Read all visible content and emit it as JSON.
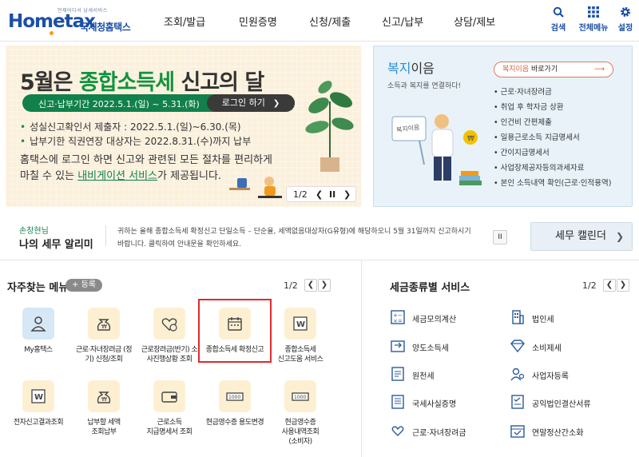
{
  "header": {
    "logo_tag": "언제어디서 납세서비스",
    "logo_text": "Hometax",
    "logo_sub": "국세청홈택스",
    "nav": [
      "조회/발급",
      "민원증명",
      "신청/제출",
      "신고/납부",
      "상담/제보"
    ],
    "util": {
      "search": "검색",
      "menu": "전체메뉴",
      "settings": "설정"
    }
  },
  "banner": {
    "title_prefix": "5월은 ",
    "title_highlight": "종합소득세",
    "title_suffix": " 신고의 달",
    "period": "신고·납부기간  2022.5.1.(일) ~ 5.31.(화)",
    "login_button": "로그인 하기",
    "bullets": [
      "성실신고확인서 제출자 : 2022.5.1.(일)~6.30.(목)",
      "납부기한 직권연장 대상자는 2022.8.31.(수)까지 납부"
    ],
    "desc_line1": "홈택스에 로그인 하면 신고와 관련된 모든 절차를 편리하게",
    "desc_line2_prefix": "마칠 수 있는 ",
    "desc_line2_link": "내비게이션 서비스",
    "desc_line2_suffix": "가 제공됩니다.",
    "pager": "1/2",
    "board_text": "복지이음"
  },
  "promo": {
    "title_blue": "복지",
    "title_rest": "이음",
    "subtitle": "소득과 복지를 연결하다!",
    "button_red": "복지이음",
    "button_rest": " 바로가기",
    "items": [
      "근로·자녀장려금",
      "취업 후 학자금 상환",
      "인건비 간편제출",
      "일용근로소득 지급명세서",
      "간이지급명세서",
      "사업장제공자등의과세자료",
      "본인 소득내역 확인(근로·인적용역)"
    ]
  },
  "notice": {
    "name": "손창현님",
    "title": "나의 세무 알리미",
    "line1": "귀하는 올해 종합소득세 확정신고 단일소득 – 단순율, 세액없음대상자(G유형)에 해당하오니 5월 31일까지 신고하시기",
    "line2": "바랍니다. 클릭하여 안내문을 확인하세요.",
    "pause": "II",
    "calendar": "세무 캘린더"
  },
  "favorites": {
    "title": "자주찾는 메뉴",
    "add": "+ 등록",
    "pager": "1/2",
    "tiles": [
      {
        "label1": "My홈택스",
        "label2": "",
        "label3": ""
      },
      {
        "label1": "근로·자녀장려금 (정",
        "label2": "기) 신청/조회",
        "label3": ""
      },
      {
        "label1": "근로장려금(반기) 소",
        "label2": "사진행상황 조회",
        "label3": ""
      },
      {
        "label1": "종합소득세 확정신고",
        "label2": "",
        "label3": ""
      },
      {
        "label1": "종합소득세",
        "label2": "신고도움 서비스",
        "label3": ""
      },
      {
        "label1": "전자신고결과조회",
        "label2": "",
        "label3": ""
      },
      {
        "label1": "납부할 세액",
        "label2": "조회납부",
        "label3": ""
      },
      {
        "label1": "근로소득",
        "label2": "지급명세서 조회",
        "label3": ""
      },
      {
        "label1": "현금영수증 용도변경",
        "label2": "",
        "label3": ""
      },
      {
        "label1": "현금영수증",
        "label2": "사용내역조회",
        "label3": "(소비자)"
      }
    ]
  },
  "tax_services": {
    "title": "세금종류별 서비스",
    "pager": "1/2",
    "items": [
      "세금모의계산",
      "법인세",
      "양도소득세",
      "소비제세",
      "원천세",
      "사업자등록",
      "국세사실증명",
      "공익법인결산서류",
      "근로·자녀장려금",
      "연말정산간소화"
    ]
  },
  "colors": {
    "brand": "#1b4fa8",
    "green": "#11804a",
    "highlight": "#e12a2a"
  }
}
